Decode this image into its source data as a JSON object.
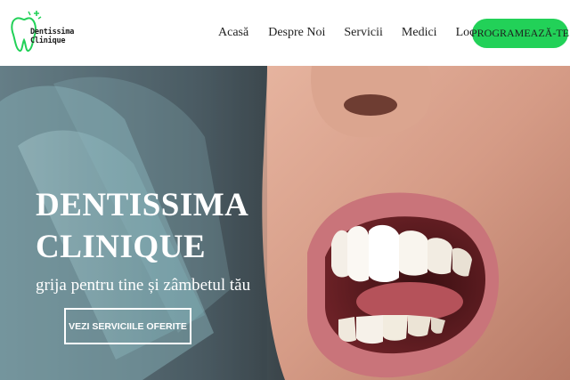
{
  "brand": {
    "name_line1": "Dentissima",
    "name_line2": "Clinique",
    "accent_color": "#22d158",
    "logo_icon": "tooth-icon"
  },
  "nav": {
    "items": [
      {
        "label": "Acasă"
      },
      {
        "label": "Despre Noi"
      },
      {
        "label": "Servicii"
      },
      {
        "label": "Medici"
      },
      {
        "label": "Locație"
      }
    ],
    "cta_label": "PROGRAMEAZĂ-TE"
  },
  "hero": {
    "title_line1": "DENTISSIMA",
    "title_line2": "CLINIQUE",
    "tagline": "grija pentru tine și zâmbetul tău",
    "button_label": "VEZI SERVICIILE OFERITE",
    "image": "smiling-mouth-photo"
  }
}
